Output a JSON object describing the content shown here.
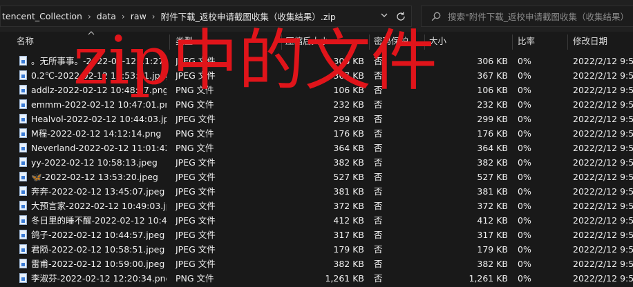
{
  "address_bar": {
    "crumbs": [
      "tencent_Collection",
      "data",
      "raw",
      "附件下载_返校申请截图收集（收集结果）.zip"
    ]
  },
  "search": {
    "placeholder": "搜索\"附件下载_返校申请截图收集（收集结果）"
  },
  "columns": {
    "name": "名称",
    "type": "类型",
    "compressed_size": "压缩后大小",
    "password": "密码保护",
    "size": "大小",
    "ratio": "比率",
    "modified": "修改日期"
  },
  "files": [
    {
      "name": "。无所事事。-2022-02-12 11:27:...",
      "type": "JPEG 文件",
      "compressed_size": "306 KB",
      "password": "否",
      "size": "306 KB",
      "ratio": "0%",
      "modified": "2022/2/12 9:55"
    },
    {
      "name": "0.2℃-2022-02-12 11:53:51.jpeg",
      "type": "JPEG 文件",
      "compressed_size": "367 KB",
      "password": "否",
      "size": "367 KB",
      "ratio": "0%",
      "modified": "2022/2/12 9:55"
    },
    {
      "name": "addlz-2022-02-12 10:48:07.png",
      "type": "PNG 文件",
      "compressed_size": "106 KB",
      "password": "否",
      "size": "106 KB",
      "ratio": "0%",
      "modified": "2022/2/12 9:55"
    },
    {
      "name": "emmm-2022-02-12 10:47:01.png",
      "type": "PNG 文件",
      "compressed_size": "232 KB",
      "password": "否",
      "size": "232 KB",
      "ratio": "0%",
      "modified": "2022/2/12 9:55"
    },
    {
      "name": "Healvol-2022-02-12 10:44:03.jp...",
      "type": "JPEG 文件",
      "compressed_size": "299 KB",
      "password": "否",
      "size": "299 KB",
      "ratio": "0%",
      "modified": "2022/2/12 9:55"
    },
    {
      "name": "M程-2022-02-12 14:12:14.png",
      "type": "PNG 文件",
      "compressed_size": "176 KB",
      "password": "否",
      "size": "176 KB",
      "ratio": "0%",
      "modified": "2022/2/12 9:55"
    },
    {
      "name": "Neverland-2022-02-12 11:01:42...",
      "type": "PNG 文件",
      "compressed_size": "364 KB",
      "password": "否",
      "size": "364 KB",
      "ratio": "0%",
      "modified": "2022/2/12 9:55"
    },
    {
      "name": "yy-2022-02-12 10:58:13.jpeg",
      "type": "JPEG 文件",
      "compressed_size": "382 KB",
      "password": "否",
      "size": "382 KB",
      "ratio": "0%",
      "modified": "2022/2/12 9:55"
    },
    {
      "name": "🦋-2022-02-12 13:53:20.jpeg",
      "type": "JPEG 文件",
      "compressed_size": "527 KB",
      "password": "否",
      "size": "527 KB",
      "ratio": "0%",
      "modified": "2022/2/12 9:55"
    },
    {
      "name": "奔奔-2022-02-12 13:45:07.jpeg",
      "type": "JPEG 文件",
      "compressed_size": "381 KB",
      "password": "否",
      "size": "381 KB",
      "ratio": "0%",
      "modified": "2022/2/12 9:55"
    },
    {
      "name": "大预言家-2022-02-12 10:49:03.jp...",
      "type": "JPEG 文件",
      "compressed_size": "372 KB",
      "password": "否",
      "size": "372 KB",
      "ratio": "0%",
      "modified": "2022/2/12 9:55"
    },
    {
      "name": "冬日里的睡不醒-2022-02-12 10:4...",
      "type": "JPEG 文件",
      "compressed_size": "412 KB",
      "password": "否",
      "size": "412 KB",
      "ratio": "0%",
      "modified": "2022/2/12 9:55"
    },
    {
      "name": "鸽子-2022-02-12 10:44:57.jpeg",
      "type": "JPEG 文件",
      "compressed_size": "317 KB",
      "password": "否",
      "size": "317 KB",
      "ratio": "0%",
      "modified": "2022/2/12 9:55"
    },
    {
      "name": "君陨-2022-02-12 10:58:51.jpeg",
      "type": "JPEG 文件",
      "compressed_size": "179 KB",
      "password": "否",
      "size": "179 KB",
      "ratio": "0%",
      "modified": "2022/2/12 9:55"
    },
    {
      "name": "雷甫-2022-02-12 10:59:00.jpeg",
      "type": "JPEG 文件",
      "compressed_size": "382 KB",
      "password": "否",
      "size": "382 KB",
      "ratio": "0%",
      "modified": "2022/2/12 9:55"
    },
    {
      "name": "李淑芬-2022-02-12 12:20:34.png",
      "type": "PNG 文件",
      "compressed_size": "1,261 KB",
      "password": "否",
      "size": "1,261 KB",
      "ratio": "0%",
      "modified": "2022/2/12 9:55"
    }
  ],
  "overlay": {
    "text": "zip中的文件",
    "color": "#e0141a"
  },
  "icons": {
    "refresh": "refresh-icon",
    "search": "search-icon",
    "dropdown": "chevron-down-icon",
    "file": "image-file-icon"
  }
}
